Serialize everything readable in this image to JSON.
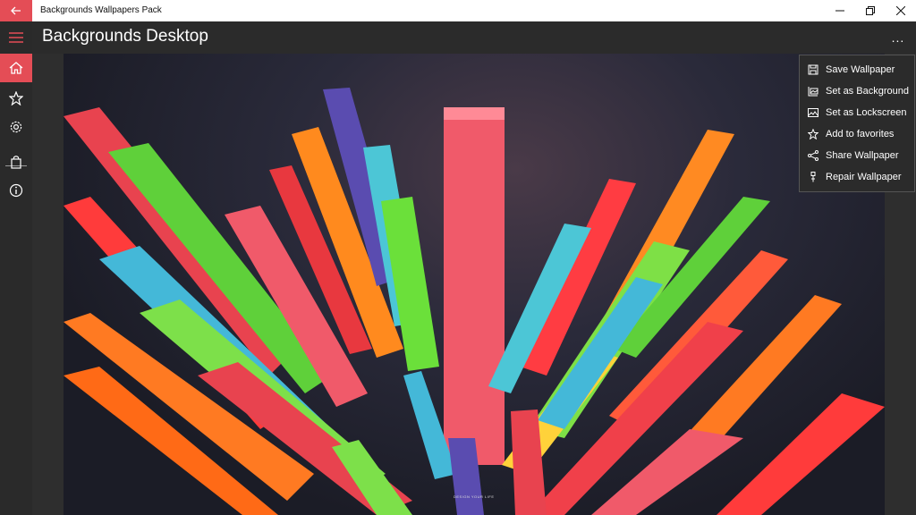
{
  "window": {
    "title": "Backgrounds Wallpapers Pack"
  },
  "header": {
    "title": "Backgrounds Desktop",
    "more_label": "..."
  },
  "nav": {
    "items": [
      {
        "name": "menu",
        "icon": "hamburger-icon"
      },
      {
        "name": "home",
        "icon": "home-icon",
        "active": true
      },
      {
        "name": "favorites",
        "icon": "star-icon"
      },
      {
        "name": "settings",
        "icon": "gear-icon"
      },
      {
        "name": "store",
        "icon": "shopping-bag-icon"
      },
      {
        "name": "about",
        "icon": "info-icon"
      }
    ]
  },
  "context_menu": {
    "items": [
      {
        "label": "Save Wallpaper",
        "icon": "save-icon"
      },
      {
        "label": "Set as Background",
        "icon": "desktop-image-icon"
      },
      {
        "label": "Set as Lockscreen",
        "icon": "picture-icon"
      },
      {
        "label": "Add to favorites",
        "icon": "star-icon"
      },
      {
        "label": "Share Wallpaper",
        "icon": "share-icon"
      },
      {
        "label": "Repair Wallpaper",
        "icon": "repair-icon"
      }
    ]
  },
  "wallpaper": {
    "caption": "DESIGN YOUR LIFE"
  },
  "colors": {
    "accent": "#e44d56",
    "sidebar": "#2a2a2a",
    "header": "#2b2b2b"
  }
}
